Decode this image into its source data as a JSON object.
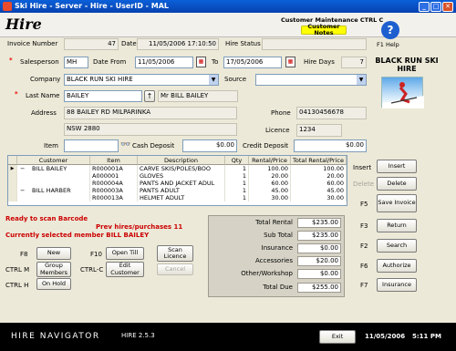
{
  "window": {
    "title": "Ski Hire - Server - Hire - UserID - MAL"
  },
  "header": {
    "title": "Hire",
    "maintenance": "Customer Maintenance CTRL C",
    "notes_button": "Customer Notes",
    "help_label": "F1 Help",
    "brand": "BLACK RUN SKI HIRE"
  },
  "form": {
    "invoice_label": "Invoice Number",
    "invoice_value": "47",
    "date_label": "Date",
    "date_value": "11/05/2006 17:10:50",
    "hire_status_label": "Hire Status",
    "salesperson_label": "Salesperson",
    "salesperson_value": "MH",
    "date_from_label": "Date From",
    "date_from_value": "11/05/2006",
    "to_label": "To",
    "to_value": "17/05/2006",
    "hire_days_label": "Hire Days",
    "hire_days_value": "7",
    "company_label": "Company",
    "company_value": "BLACK RUN SKI HIRE",
    "source_label": "Source",
    "last_name_label": "Last Name",
    "last_name_value": "BAILEY",
    "customer_name": "Mr BILL BAILEY",
    "address_label": "Address",
    "address_line1": "88 BAILEY RD  MILPARINKA",
    "address_line2": "NSW 2880",
    "phone_label": "Phone",
    "phone_value": "04130456678",
    "licence_label": "Licence",
    "licence_value": "1234",
    "item_label": "Item",
    "cash_deposit_label": "Cash Deposit",
    "cash_deposit_value": "$0.00",
    "credit_deposit_label": "Credit Deposit",
    "credit_deposit_value": "$0.00"
  },
  "grid": {
    "headers": [
      "Customer",
      "Item",
      "Description",
      "Qty",
      "Rental/Price",
      "Total Rental/Price"
    ],
    "rows": [
      {
        "marker": "▶",
        "expand": "−",
        "customer": "BILL BAILEY",
        "item": "R000001A",
        "desc": "CARVE SKIS/POLES/BOO",
        "qty": "1",
        "price": "100.00",
        "total": "100.00"
      },
      {
        "marker": "",
        "expand": "",
        "customer": "",
        "item": "A000001",
        "desc": "GLOVES",
        "qty": "1",
        "price": "20.00",
        "total": "20.00"
      },
      {
        "marker": "",
        "expand": "",
        "customer": "",
        "item": "R000004A",
        "desc": "PANTS AND JACKET ADUL",
        "qty": "1",
        "price": "60.00",
        "total": "60.00"
      },
      {
        "marker": "",
        "expand": "−",
        "customer": "BILL HARBER",
        "item": "R000003A",
        "desc": "PANTS ADULT",
        "qty": "1",
        "price": "45.00",
        "total": "45.00"
      },
      {
        "marker": "",
        "expand": "",
        "customer": "",
        "item": "R000013A",
        "desc": "HELMET ADULT",
        "qty": "1",
        "price": "30.00",
        "total": "30.00"
      }
    ]
  },
  "side_buttons": {
    "insert_key": "Insert",
    "insert": "Insert",
    "delete_key": "Delete",
    "delete": "Delete",
    "save_key": "F5",
    "save": "Save Invoice",
    "return_key": "F3",
    "return": "Return",
    "search_key": "F2",
    "search": "Search",
    "authorize_key": "F6",
    "authorize": "Authorize",
    "insurance_key": "F7",
    "insurance": "Insurance"
  },
  "messages": {
    "scan": "Ready to scan Barcode",
    "prev_hires": "Prev hires/purchases 11",
    "selected": "Currently selected member BILL BAILEY"
  },
  "bottom_buttons": {
    "new_key": "F8",
    "new": "New",
    "open_till_key": "F10",
    "open_till": "Open Till",
    "scan_licence": "Scan Licence",
    "group_key": "CTRL M",
    "group": "Group Members",
    "edit_key": "CTRL-C",
    "edit": "Edit Customer",
    "cancel": "Cancel",
    "hold_key": "CTRL H",
    "hold": "On Hold"
  },
  "totals": {
    "total_rental_label": "Total Rental",
    "total_rental": "$235.00",
    "sub_total_label": "Sub Total",
    "sub_total": "$235.00",
    "insurance_label": "Insurance",
    "insurance": "$0.00",
    "accessories_label": "Accessories",
    "accessories": "$20.00",
    "other_label": "Other/Workshop",
    "other": "$0.00",
    "total_due_label": "Total Due",
    "total_due": "$255.00"
  },
  "status": {
    "app_name": "HIRE  NAVIGATOR",
    "version": "HIRE 2.5.3",
    "exit": "Exit",
    "date": "11/05/2006",
    "time": "5:11 PM"
  },
  "colors": {
    "accent_blue": "#0A5FD8",
    "message_red": "#CC0000",
    "notes_yellow": "#FFFF00"
  }
}
